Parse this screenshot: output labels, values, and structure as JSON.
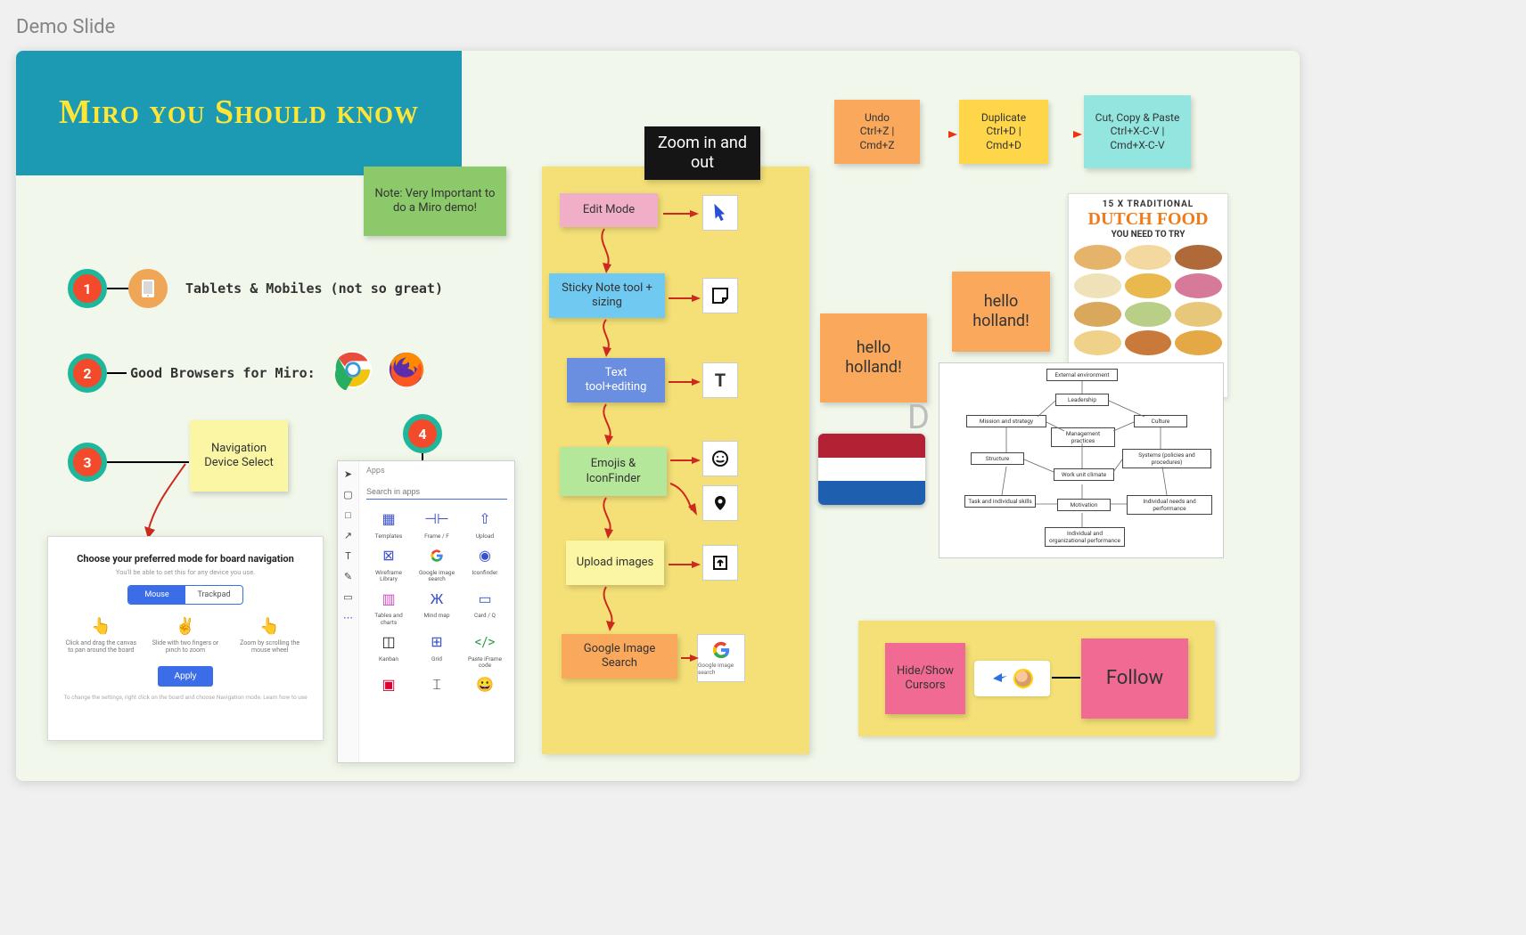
{
  "page_title": "Demo Slide",
  "banner_title": "Miro you Should know",
  "note_sticky": "Note: Very Important to do a Miro demo!",
  "points": {
    "p1": {
      "num": "1",
      "text": "Tablets & Mobiles (not so great)"
    },
    "p2": {
      "num": "2",
      "text": "Good Browsers for Miro:"
    },
    "p3": {
      "num": "3",
      "sticky": "Navigation Device Select"
    },
    "p4": {
      "num": "4"
    }
  },
  "nav_modal": {
    "title": "Choose your preferred mode for board navigation",
    "subtitle": "You'll be able to set this for any device you use.",
    "opt_mouse": "Mouse",
    "opt_trackpad": "Trackpad",
    "g1": "Click and drag the canvas to pan around the board",
    "g2": "Slide with two fingers or pinch to zoom",
    "g3": "Zoom by scrolling the mouse wheel",
    "apply": "Apply",
    "footer": "To change the settings, right click on the board and choose Navigation mode. Learn how to use"
  },
  "apps_panel": {
    "heading": "Apps",
    "search_placeholder": "Search in apps",
    "items": [
      "Templates",
      "Frame / F",
      "Upload",
      "Wireframe Library",
      "Google image search",
      "Iconfinder",
      "Tables and charts",
      "Mind map",
      "Card / Q",
      "Kanban",
      "Grid",
      "Paste iFrame code"
    ]
  },
  "tool_column": {
    "header": "Zoom in and out",
    "rows": [
      {
        "label": "Edit Mode",
        "class": "pink"
      },
      {
        "label": "Sticky Note tool + sizing",
        "class": "blue"
      },
      {
        "label": "Text tool+editing",
        "class": "blue"
      },
      {
        "label": "Emojis & IconFinder",
        "class": "lgreen"
      },
      {
        "label": "Upload images",
        "class": "yellow"
      },
      {
        "label": "Google Image Search",
        "class": "orange"
      }
    ],
    "google_caption": "Google image search"
  },
  "shortcuts": {
    "undo": "Undo\nCtrl+Z | Cmd+Z",
    "duplicate": "Duplicate\nCtrl+D | Cmd+D",
    "cutcopy": "Cut, Copy & Paste\nCtrl+X-C-V | Cmd+X-C-V"
  },
  "holland": {
    "a": "hello holland!",
    "b": "hello holland!",
    "letter": "D"
  },
  "follow": {
    "left": "Hide/Show Cursors",
    "right": "Follow"
  },
  "dutch_card": {
    "line1": "15 X TRADITIONAL",
    "line2": "DUTCH FOOD",
    "line3": "YOU NEED TO TRY"
  },
  "diagram_nodes": [
    "External environment",
    "Leadership",
    "Mission and strategy",
    "Culture",
    "Management practices",
    "Structure",
    "Systems (policies and procedures)",
    "Work unit climate",
    "Task and individual skills",
    "Motivation",
    "Individual needs and performance",
    "Individual and organizational performance"
  ]
}
